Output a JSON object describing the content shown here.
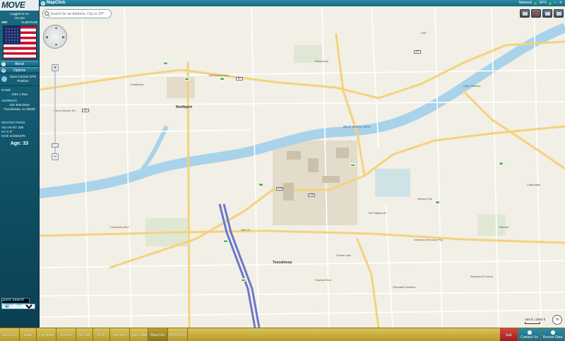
{
  "app": {
    "logo": "MOVE",
    "window_title": "MapClick"
  },
  "sidebar": {
    "login_status": "Logged In As",
    "username": "dscu88",
    "ori_label": "ORI",
    "ori_value": "AL6576100",
    "about_label": "About",
    "options_label": "Options",
    "save_gps_label": "Save Current GPS Position",
    "name_label": "NAME",
    "name_value": "John J Doe",
    "address_label": "ADDRESS",
    "address_line1": "123 Test Drive",
    "address_line2": "Tuscaloosa, AL 35405",
    "restrictions_label": "RESTRICTIONS",
    "sex_label": "SEX",
    "sex_value": "M",
    "wt_label": "WT",
    "wt_value": "200",
    "ht_label": "HT",
    "ht_value": "6' 2\"",
    "dob_label": "DOB",
    "dob_value": "11/30/1979",
    "age_label": "Age:",
    "age_value": "33",
    "quick_search_label": "Quick Search",
    "search_type_label": "Search Type",
    "search_type_value": "All"
  },
  "titlebar": {
    "network_label": "Network",
    "gps_label": "GPS",
    "status_color": "#2bd13a"
  },
  "map": {
    "search_placeholder": "Search for an Address, City or ZIP",
    "scale_text": "500 ft / 2000 ft",
    "labels": {
      "northport": "Northport",
      "tuscaloosa": "Tuscaloosa",
      "mcfarland": "McFarland Blvd",
      "carroll": "Carroll Airport Rd",
      "university": "University Blvd",
      "fifteenth": "15th St",
      "skyland": "Skyland Blvd",
      "veterans": "Veterans Memorial Pky",
      "river": "Black Warrior River",
      "crestwood": "Crestwood",
      "riverwood": "Riverwood",
      "hillcrest": "Hillcrest",
      "alberta": "Alberta City",
      "lake_lurleen": "Lake Tamaha",
      "highlands": "The Highlands",
      "woodland": "Woodland Forrest",
      "glendale": "Glendale Gardens",
      "forest_lake": "Forest Lake",
      "cottondale": "Cottondale",
      "holt": "Holt"
    },
    "shields": [
      "43",
      "69",
      "13",
      "82",
      "215",
      "216",
      "6",
      "69",
      "11",
      "171",
      "297",
      "30",
      "20",
      "59"
    ]
  },
  "taskbar": {
    "buttons": [
      "LETS Go",
      "eCite",
      "Log Book",
      "eCrash",
      "ULTRA",
      "NCIC",
      "eForms",
      "Quick SAR",
      "MapClick",
      "HOTDOCS"
    ],
    "active": "MapClick",
    "exit_label": "Exit",
    "contact_label": "Contact Us",
    "recent_label": "Recent Data"
  }
}
